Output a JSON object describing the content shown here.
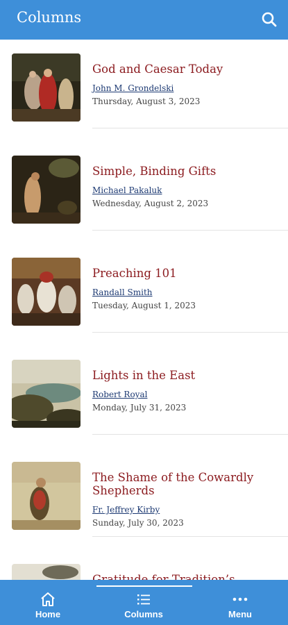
{
  "appbar": {
    "title": "Columns"
  },
  "articles": [
    {
      "title": "God and Caesar Today",
      "author": "John M. Grondelski",
      "date": "Thursday, August 3, 2023"
    },
    {
      "title": "Simple, Binding Gifts",
      "author": "Michael Pakaluk",
      "date": "Wednesday, August 2, 2023"
    },
    {
      "title": "Preaching 101",
      "author": "Randall Smith",
      "date": "Tuesday, August 1, 2023"
    },
    {
      "title": "Lights in the East",
      "author": "Robert Royal",
      "date": "Monday, July 31, 2023"
    },
    {
      "title": "The Shame of the Cowardly Shepherds",
      "author": "Fr. Jeffrey Kirby",
      "date": "Sunday, July 30, 2023"
    },
    {
      "title": "Gratitude for Tradition’s",
      "author": "",
      "date": ""
    }
  ],
  "bottom_nav": [
    {
      "label": "Home",
      "icon": "home-icon"
    },
    {
      "label": "Columns",
      "icon": "list-icon",
      "active": true
    },
    {
      "label": "Menu",
      "icon": "more-dots-icon"
    }
  ],
  "colors": {
    "bar": "#3e8fd9",
    "title": "#8c1c20",
    "author": "#1d3a73"
  }
}
